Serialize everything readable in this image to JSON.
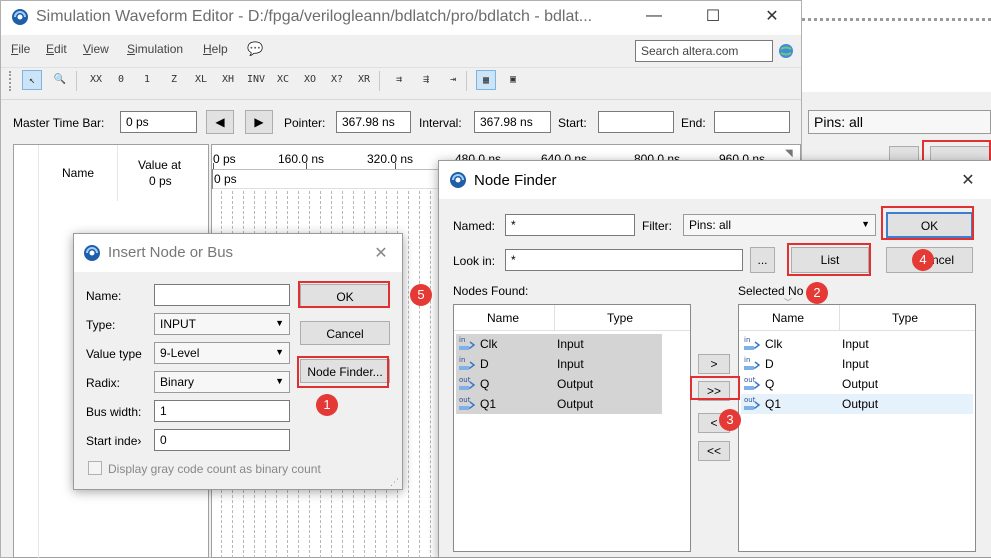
{
  "main_window": {
    "title": "Simulation Waveform Editor - D:/fpga/verilogleann/bdlatch/pro/bdlatch - bdlat...",
    "menu": [
      {
        "label": "File",
        "u": "F",
        "rest": "ile"
      },
      {
        "label": "Edit",
        "u": "E",
        "rest": "dit"
      },
      {
        "label": "View",
        "u": "V",
        "rest": "iew"
      },
      {
        "label": "Simulation",
        "u": "S",
        "rest": "imulation"
      },
      {
        "label": "Help",
        "u": "H",
        "rest": "elp"
      }
    ],
    "search_placeholder": "Search altera.com",
    "toolbar_icons": [
      "select-arrow-icon",
      "zoom-icon",
      "forcing-unknown-icon",
      "forcing-low-icon",
      "forcing-high-icon",
      "high-impedance-icon",
      "weak-low-icon",
      "weak-high-icon",
      "invert-icon",
      "count-value-icon",
      "clock-value-icon",
      "arbitrary-value-icon",
      "random-value-icon",
      "snap-icon",
      "grid-icon",
      "time-icon",
      "waveform-icon",
      "node-icon"
    ],
    "toolbar_glyphs": [
      "↖",
      "🔍",
      "XX",
      "0",
      "1",
      "Z",
      "XL",
      "XH",
      "INV",
      "XC",
      "XO",
      "X?",
      "XR",
      "⇉",
      "⇶",
      "⇥",
      "▦",
      "▣"
    ],
    "time_bar": {
      "master_label": "Master Time Bar:",
      "master_value": "0 ps",
      "pointer_label": "Pointer:",
      "pointer_value": "367.98 ns",
      "interval_label": "Interval:",
      "interval_value": "367.98 ns",
      "start_label": "Start:",
      "start_value": "",
      "end_label": "End:",
      "end_value": ""
    },
    "node_table": {
      "name_header": "Name",
      "value_header_line1": "Value at",
      "value_header_line2": "0 ps"
    },
    "timeline_ticks": [
      "0 ps",
      "160.0 ns",
      "320.0 ns",
      "480.0 ns",
      "640.0 ns",
      "800.0 ns",
      "960.0 ns"
    ],
    "timeline_cursor_label": "0 ps",
    "right_pins_filter": "Pins: all"
  },
  "insert_dialog": {
    "title": "Insert Node or Bus",
    "name_label": "Name:",
    "name_value": "",
    "type_label": "Type:",
    "type_value": "INPUT",
    "value_type_label": "Value type",
    "value_type_value": "9-Level",
    "radix_label": "Radix:",
    "radix_value": "Binary",
    "bus_width_label": "Bus width:",
    "bus_width_value": "1",
    "start_index_label": "Start inde›",
    "start_index_value": "0",
    "ok_label": "OK",
    "cancel_label": "Cancel",
    "node_finder_label": "Node Finder...",
    "gray_code_label": "Display gray code count as binary count"
  },
  "node_finder": {
    "title": "Node Finder",
    "named_label": "Named:",
    "named_value": "*",
    "filter_label": "Filter:",
    "filter_value": "Pins: all",
    "look_in_label": "Look in:",
    "look_in_value": "*",
    "browse_label": "...",
    "list_label": "List",
    "ok_label": "OK",
    "cancel_label": "ncel",
    "nodes_found_label": "Nodes Found:",
    "selected_label": "Selected No",
    "col_name": "Name",
    "col_type": "Type",
    "found_nodes": [
      {
        "dir": "in",
        "name": "Clk",
        "type": "Input"
      },
      {
        "dir": "in",
        "name": "D",
        "type": "Input"
      },
      {
        "dir": "out",
        "name": "Q",
        "type": "Output"
      },
      {
        "dir": "out",
        "name": "Q1",
        "type": "Output"
      }
    ],
    "selected_nodes": [
      {
        "dir": "in",
        "name": "Clk",
        "type": "Input"
      },
      {
        "dir": "in",
        "name": "D",
        "type": "Input"
      },
      {
        "dir": "out",
        "name": "Q",
        "type": "Output"
      },
      {
        "dir": "out",
        "name": "Q1",
        "type": "Output"
      }
    ],
    "move_one": ">",
    "move_all": ">>",
    "remove_one": "<",
    "remove_all": "<<"
  },
  "badges": [
    "1",
    "2",
    "3",
    "4",
    "5"
  ],
  "colors": {
    "highlight": "#e23030",
    "badge": "#e53935",
    "selected_row": "#e5f1fb",
    "found_row": "#d4d4d4"
  }
}
